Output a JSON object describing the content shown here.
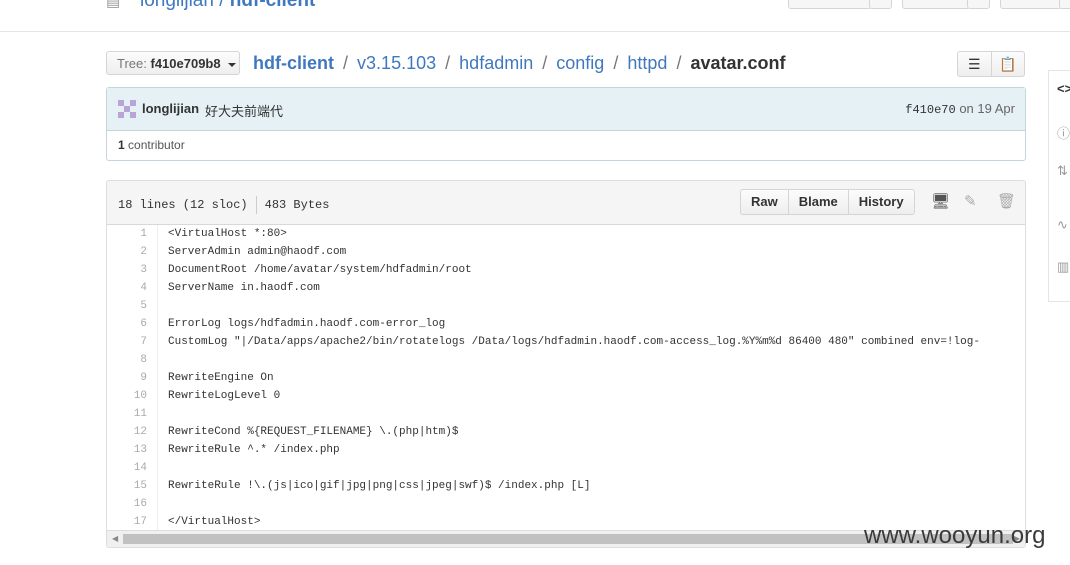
{
  "header": {
    "owner": "longlijian",
    "separator": "/",
    "repo": "hdf-client"
  },
  "tree": {
    "label": "Tree:",
    "sha": "f410e709b8"
  },
  "breadcrumb": {
    "repo": "hdf-client",
    "parts": [
      "v3.15.103",
      "hdfadmin",
      "config",
      "httpd"
    ],
    "file": "avatar.conf",
    "sep": "/"
  },
  "commit": {
    "author": "longlijian",
    "message": "好大夫前端代",
    "sha": "f410e70",
    "on": "on",
    "date": "19 Apr",
    "contributor_count": "1",
    "contributor_label": "contributor"
  },
  "file": {
    "lines_info": "18 lines (12 sloc)",
    "size": "483 Bytes",
    "buttons": {
      "raw": "Raw",
      "blame": "Blame",
      "history": "History"
    }
  },
  "code_lines": [
    "<VirtualHost *:80>",
    "ServerAdmin admin@haodf.com",
    "DocumentRoot /home/avatar/system/hdfadmin/root",
    "ServerName in.haodf.com",
    "",
    "ErrorLog logs/hdfadmin.haodf.com-error_log",
    "CustomLog \"|/Data/apps/apache2/bin/rotatelogs /Data/logs/hdfadmin.haodf.com-access_log.%Y%m%d 86400 480\" combined env=!log-",
    "",
    "RewriteEngine On",
    "RewriteLogLevel 0",
    "",
    "RewriteCond %{REQUEST_FILENAME} \\.(php|htm)$",
    "RewriteRule ^.* /index.php",
    "",
    "RewriteRule !\\.(js|ico|gif|jpg|png|css|jpeg|swf)$ /index.php [L]",
    "",
    "</VirtualHost>"
  ],
  "watermark": "www.wooyun.org",
  "icons": {
    "repo": "repo-icon",
    "tree_caret": "caret-down-icon",
    "list": "list-icon",
    "clipboard": "clipboard-icon",
    "display": "desktop-icon",
    "pencil": "pencil-icon",
    "trash": "trash-icon"
  }
}
